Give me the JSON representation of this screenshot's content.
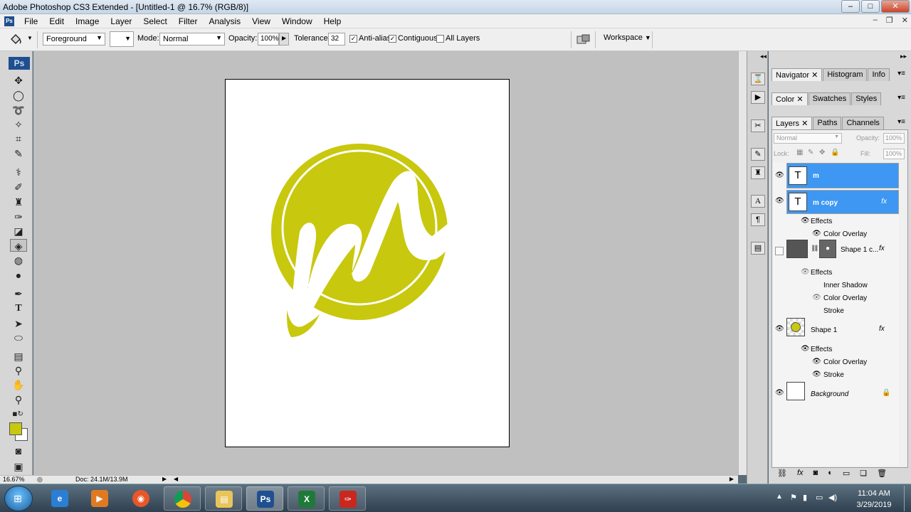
{
  "window": {
    "title": "Adobe Photoshop CS3 Extended - [Untitled-1 @ 16.7% (RGB/8)]"
  },
  "menu": [
    "File",
    "Edit",
    "Image",
    "Layer",
    "Select",
    "Filter",
    "Analysis",
    "View",
    "Window",
    "Help"
  ],
  "options": {
    "fill_source": "Foreground",
    "mode_label": "Mode:",
    "mode_value": "Normal",
    "opacity_label": "Opacity:",
    "opacity_value": "100%",
    "tolerance_label": "Tolerance:",
    "tolerance_value": "32",
    "antialias": "Anti-alias",
    "contiguous": "Contiguous",
    "all_layers": "All Layers",
    "workspace": "Workspace"
  },
  "tools": {
    "logo": "Ps",
    "foreground_color": "#c8c811",
    "background_color": "#ffffff"
  },
  "status": {
    "zoom": "16.67%",
    "doc": "Doc: 24.1M/13.9M"
  },
  "panels": {
    "group1_tabs": [
      "Navigator",
      "Histogram",
      "Info"
    ],
    "group2_tabs": [
      "Color",
      "Swatches",
      "Styles"
    ],
    "group3_tabs": [
      "Layers",
      "Paths",
      "Channels"
    ],
    "blend_mode": "Normal",
    "opacity_label": "Opacity:",
    "opacity_value": "100%",
    "lock_label": "Lock:",
    "fill_label": "Fill:",
    "fill_value": "100%"
  },
  "layers": {
    "l1_name": "m",
    "l2_name": "m copy",
    "l2_effects": "Effects",
    "l2_e1": "Color Overlay",
    "l3_name": "Shape 1 c...",
    "l3_effects": "Effects",
    "l3_e1": "Inner Shadow",
    "l3_e2": "Color Overlay",
    "l3_e3": "Stroke",
    "l4_name": "Shape 1",
    "l4_effects": "Effects",
    "l4_e1": "Color Overlay",
    "l4_e2": "Stroke",
    "l5_name": "Background",
    "fx_symbol": "fx",
    "thumb_text": "T"
  },
  "artwork": {
    "logo_color": "#c8c80e"
  },
  "taskbar": {
    "time": "11:04 AM",
    "date": "3/29/2019",
    "apps": [
      "internet-explorer",
      "media-player",
      "firefox",
      "chrome",
      "file-explorer",
      "photoshop",
      "excel",
      "acrobat"
    ]
  }
}
